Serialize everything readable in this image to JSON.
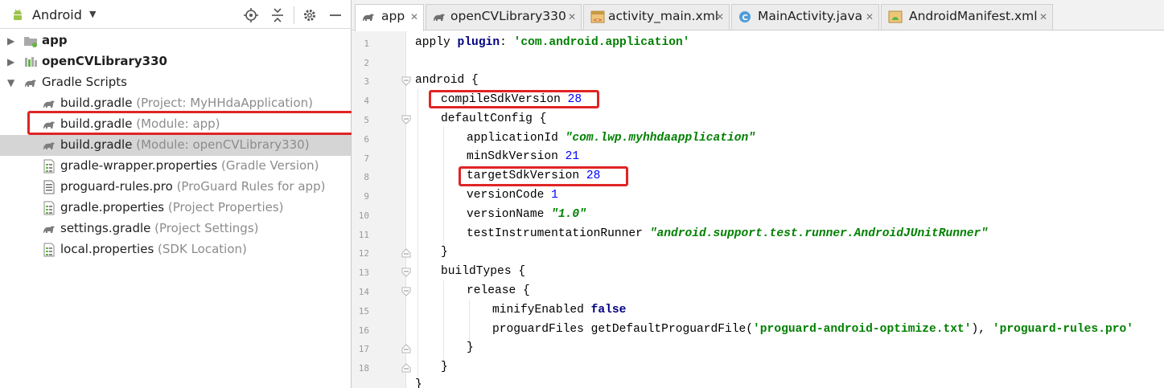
{
  "project_panel": {
    "view_label": "Android",
    "icons": {
      "view_icon": "android-icon",
      "sync": "locate-target-icon",
      "collapse": "collapse-all-icon",
      "settings": "gear-icon",
      "hide": "minimize-icon"
    },
    "tree": {
      "app": {
        "label": "app"
      },
      "opencv": {
        "label": "openCVLibrary330"
      },
      "gradle_scripts": {
        "label": "Gradle Scripts"
      },
      "files": [
        {
          "name": "build.gradle",
          "desc": "(Project: MyHHdaApplication)"
        },
        {
          "name": "build.gradle",
          "desc": "(Module: app)"
        },
        {
          "name": "build.gradle",
          "desc": "(Module: openCVLibrary330)"
        },
        {
          "name": "gradle-wrapper.properties",
          "desc": "(Gradle Version)"
        },
        {
          "name": "proguard-rules.pro",
          "desc": "(ProGuard Rules for app)"
        },
        {
          "name": "gradle.properties",
          "desc": "(Project Properties)"
        },
        {
          "name": "settings.gradle",
          "desc": "(Project Settings)"
        },
        {
          "name": "local.properties",
          "desc": "(SDK Location)"
        }
      ]
    }
  },
  "editor": {
    "tabs": [
      {
        "label": "app",
        "icon": "gradle-icon",
        "active": true
      },
      {
        "label": "openCVLibrary330",
        "icon": "gradle-icon"
      },
      {
        "label": "activity_main.xml",
        "icon": "layout-xml-icon"
      },
      {
        "label": "MainActivity.java",
        "icon": "java-class-icon"
      },
      {
        "label": "AndroidManifest.xml",
        "icon": "manifest-icon"
      }
    ],
    "line_numbers": [
      "1",
      "2",
      "3",
      "4",
      "5",
      "6",
      "7",
      "8",
      "9",
      "10",
      "11",
      "12",
      "13",
      "14",
      "15",
      "16",
      "17",
      "18"
    ],
    "code": {
      "l1": {
        "a": "apply ",
        "b": "plugin",
        "c": ": ",
        "d": "'com.android.application'"
      },
      "l3": {
        "a": "android {"
      },
      "l4": {
        "a": "compileSdkVersion ",
        "b": "28"
      },
      "l5": {
        "a": "defaultConfig {"
      },
      "l6": {
        "a": "applicationId ",
        "b": "\"com.lwp.myhhdaapplication\""
      },
      "l7": {
        "a": "minSdkVersion ",
        "b": "21"
      },
      "l8": {
        "a": "targetSdkVersion ",
        "b": "28"
      },
      "l9": {
        "a": "versionCode ",
        "b": "1"
      },
      "l10": {
        "a": "versionName ",
        "b": "\"1.0\""
      },
      "l11": {
        "a": "testInstrumentationRunner ",
        "b": "\"android.support.test.runner.AndroidJUnitRunner\""
      },
      "l12": {
        "a": "}"
      },
      "l13": {
        "a": "buildTypes {"
      },
      "l14": {
        "a": "release {"
      },
      "l15": {
        "a": "minifyEnabled ",
        "b": "false"
      },
      "l16": {
        "a": "proguardFiles getDefaultProguardFile(",
        "b": "'proguard-android-optimize.txt'",
        "c": "), ",
        "d": "'proguard-rules.pro'"
      },
      "l17": {
        "a": "}"
      },
      "l18": {
        "a": "}"
      },
      "l19": {
        "a": "}"
      }
    }
  },
  "colors": {
    "highlight_box": "#e02424",
    "keyword": "#000080",
    "string": "#008000",
    "number": "#0000ff",
    "selection": "#d5d5d5"
  }
}
